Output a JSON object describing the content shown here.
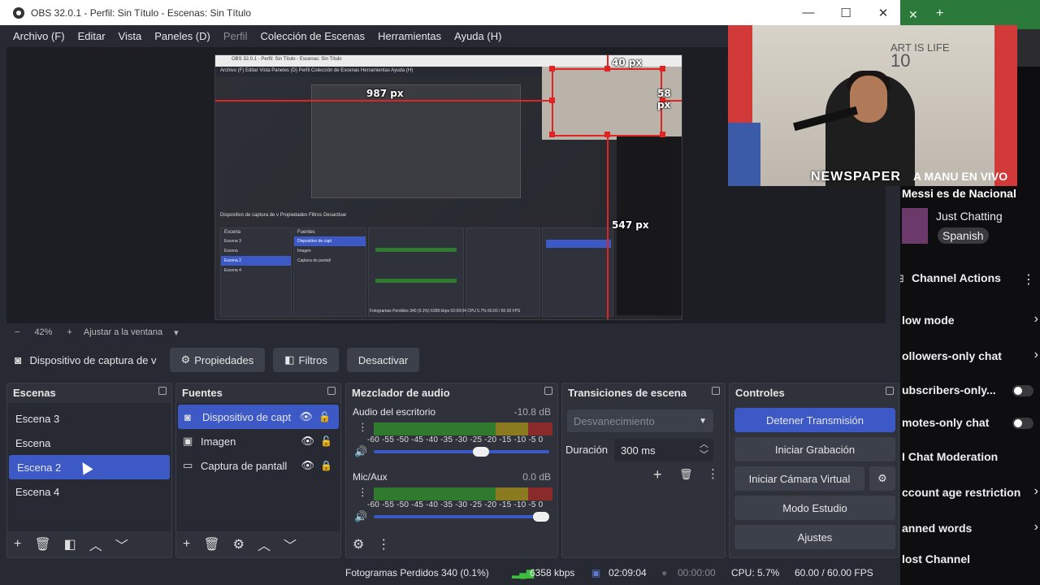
{
  "window": {
    "title": "OBS 32.0.1 - Perfil: Sin Título - Escenas: Sin Título",
    "minimize": "—",
    "maximize": "☐",
    "close": "✕"
  },
  "menu": [
    "Archivo (F)",
    "Editar",
    "Vista",
    "Paneles (D)",
    "Perfil",
    "Colección de Escenas",
    "Herramientas",
    "Ayuda (H)"
  ],
  "preview": {
    "labels": {
      "top": "40 px",
      "left": "987 px",
      "right": "58 px",
      "bottom": "547 px"
    },
    "inner_title": "OBS 32.0.1 - Perfil: Sin Título - Escenas: Sin Título",
    "inner_menu": "Archivo (F)   Editar   Vista   Paneles (D)   Perfil   Colección de Escenas   Herramientas   Ayuda (H)",
    "inner_source_bar": "Dispositivo de captura de v   Propiedades   Filtros   Desactivar",
    "inner_escenas": [
      "Escena 3",
      "Escena",
      "Escena 2",
      "Escena 4"
    ],
    "inner_fuentes": [
      "Dispositivo de capt",
      "Imagen",
      "Captura de pantall"
    ],
    "inner_status": "Fotogramas Perdidos 340 (0.1%)   6358 kbps   02:09:04   CPU 5.7%   60.00 / 60.00 FPS"
  },
  "overlay": {
    "newspaper": "NEWSPAPER",
    "stream_title": "A MANU EN VIVO",
    "subtitle": "Messi es de Nacional",
    "wall_text": "ART IS LIFE",
    "number": "10"
  },
  "twitch": {
    "category": "Just Chatting",
    "tag": "Spanish",
    "channel_actions": "Channel Actions",
    "items": [
      "low mode",
      "ollowers-only chat",
      "ubscribers-only...",
      "motes-only chat",
      "I Chat Moderation",
      "ccount age restriction",
      "anned words",
      "lost Channel"
    ]
  },
  "zoom": {
    "minus": "−",
    "level": "42%",
    "plus": "+",
    "fit": "Ajustar a la ventana"
  },
  "source_toolbar": {
    "source_name": "Dispositivo de captura de v",
    "properties": "Propiedades",
    "filters": "Filtros",
    "deactivate": "Desactivar"
  },
  "escenas": {
    "title": "Escenas",
    "items": [
      "Escena 3",
      "Escena",
      "Escena 2",
      "Escena 4"
    ],
    "selected": "Escena 2"
  },
  "fuentes": {
    "title": "Fuentes",
    "items": [
      {
        "label": "Dispositivo de capt",
        "icon": "camera-icon"
      },
      {
        "label": "Imagen",
        "icon": "image-icon"
      },
      {
        "label": "Captura de pantall",
        "icon": "monitor-icon"
      }
    ]
  },
  "mixer": {
    "title": "Mezclador de audio",
    "channels": [
      {
        "name": "Audio del escritorio",
        "db": "-10.8 dB",
        "volume": 0.62
      },
      {
        "name": "Mic/Aux",
        "db": "0.0 dB",
        "volume": 1.0
      }
    ],
    "scale": "-60 -55 -50 -45 -40 -35 -30 -25 -20 -15 -10 -5 0"
  },
  "transitions": {
    "title": "Transiciones de escena",
    "combo": "Desvanecimiento",
    "duration_label": "Duración",
    "duration_value": "300 ms"
  },
  "controls": {
    "title": "Controles",
    "stop_stream": "Detener Transmisión",
    "start_recording": "Iniciar Grabación",
    "virtual_cam": "Iniciar Cámara Virtual",
    "studio_mode": "Modo Estudio",
    "settings": "Ajustes"
  },
  "status": {
    "dropped": "Fotogramas Perdidos 340 (0.1%)",
    "bitrate": "6358 kbps",
    "stream_time": "02:09:04",
    "record_time": "00:00:00",
    "cpu": "CPU: 5.7%",
    "fps": "60.00 / 60.00 FPS"
  },
  "colors": {
    "accent": "#3c59c6",
    "red_guides": "#e02424",
    "panel": "#2f323b",
    "bg": "#272a33"
  }
}
